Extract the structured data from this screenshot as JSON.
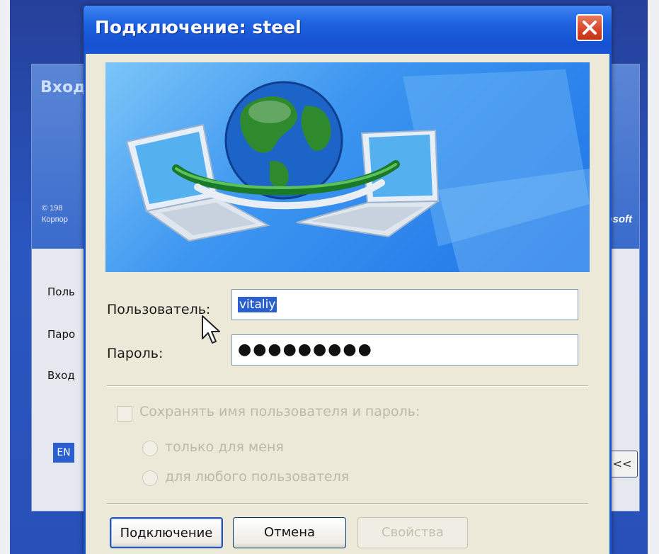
{
  "background_window": {
    "title": "Вход",
    "copyright": "© 198",
    "company": "Корпор",
    "brand": "osoft",
    "labels": [
      "Поль",
      "Паро",
      "Вход"
    ],
    "lang_indicator": "EN",
    "options_button": "<<"
  },
  "dialog": {
    "title": "Подключение: steel",
    "close_icon": "close-x-icon",
    "banner_icon": "network-globe-laptops-illustration",
    "username": {
      "label": "Пользователь:",
      "value": "vitaliy"
    },
    "password": {
      "label": "Пароль:",
      "value": "●●●●●●●●●"
    },
    "save_credentials": {
      "label": "Сохранять имя пользователя и пароль:",
      "checked": false,
      "enabled": false
    },
    "options": [
      {
        "label": "только для меня",
        "enabled": false
      },
      {
        "label": "для любого пользователя",
        "enabled": false
      }
    ],
    "buttons": {
      "connect": "Подключение",
      "cancel": "Отмена",
      "properties": "Свойства"
    }
  },
  "colors": {
    "titlebar": "#1f64e2",
    "selection": "#2a5fd0",
    "close": "#d8432a",
    "dialog_bg": "#ece9d8"
  }
}
